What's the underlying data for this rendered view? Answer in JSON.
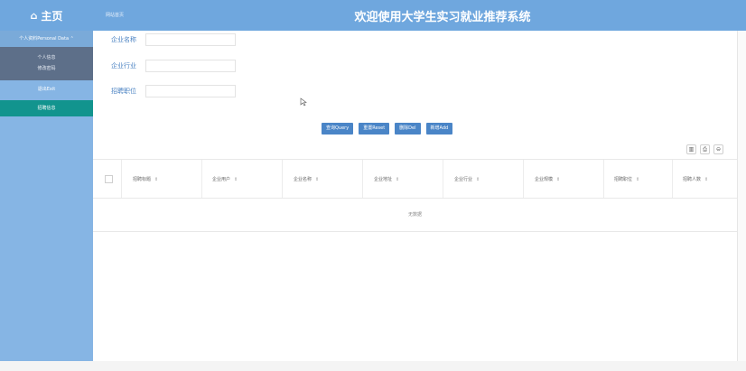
{
  "header": {
    "home_icon": "home-icon",
    "home_label": "主页",
    "breadcrumb": "网站首页",
    "title": "欢迎使用大学生实习就业推荐系统"
  },
  "sidebar": {
    "group_label": "个人资料Personal Data  ⌃",
    "sub_items": [
      "个人信息",
      "修改密码"
    ],
    "logout_label": "退出Exit",
    "active_label": "招聘信息"
  },
  "search": {
    "company_name_label": "企业名称",
    "company_industry_label": "企业行业",
    "job_position_label": "招聘职位"
  },
  "actions": {
    "query_label": "查询Query",
    "reset_label": "重置Reset",
    "delete_label": "删除Del",
    "add_label": "新增Add"
  },
  "toolbar": {
    "icons": [
      "columns-icon",
      "print-icon",
      "export-icon"
    ]
  },
  "table": {
    "columns": [
      "招聘标题",
      "企业用户",
      "企业名称",
      "企业地址",
      "企业行业",
      "企业规模",
      "招聘职位",
      "招聘人数"
    ],
    "empty_text": "无数据"
  },
  "colors": {
    "header": "#6fa7de",
    "sidebar": "#86b5e4",
    "submenu": "#5d6f89",
    "active": "#12948e",
    "button": "#4a85c7"
  }
}
